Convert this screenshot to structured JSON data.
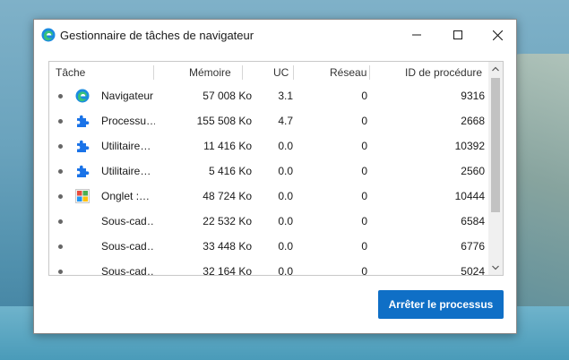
{
  "window": {
    "title": "Gestionnaire de tâches de navigateur"
  },
  "table": {
    "columns": [
      "Tâche",
      "Mémoire",
      "UC",
      "Réseau",
      "ID de procédure"
    ],
    "rows": [
      {
        "icon": "edge-icon",
        "name": "Navigateur",
        "memory": "57 008 Ko",
        "cpu": "3.1",
        "network": "0",
        "pid": "9316"
      },
      {
        "icon": "puzzle-icon",
        "name": "Processu…",
        "memory": "155 508 Ko",
        "cpu": "4.7",
        "network": "0",
        "pid": "2668"
      },
      {
        "icon": "puzzle-icon",
        "name": "Utilitaire…",
        "memory": "11 416 Ko",
        "cpu": "0.0",
        "network": "0",
        "pid": "10392"
      },
      {
        "icon": "puzzle-icon",
        "name": "Utilitaire…",
        "memory": "5 416 Ko",
        "cpu": "0.0",
        "network": "0",
        "pid": "2560"
      },
      {
        "icon": "tab-grid-icon",
        "name": "Onglet :…",
        "memory": "48 724 Ko",
        "cpu": "0.0",
        "network": "0",
        "pid": "10444"
      },
      {
        "icon": "",
        "name": "Sous-cad…",
        "memory": "22 532 Ko",
        "cpu": "0.0",
        "network": "0",
        "pid": "6584"
      },
      {
        "icon": "",
        "name": "Sous-cad…",
        "memory": "33 448 Ko",
        "cpu": "0.0",
        "network": "0",
        "pid": "6776"
      },
      {
        "icon": "",
        "name": "Sous-cad…",
        "memory": "32 164 Ko",
        "cpu": "0.0",
        "network": "0",
        "pid": "5024"
      }
    ]
  },
  "actions": {
    "end_process_label": "Arrêter le processus"
  },
  "colors": {
    "accent": "#0f6fc6",
    "puzzle": "#1a73e8"
  }
}
